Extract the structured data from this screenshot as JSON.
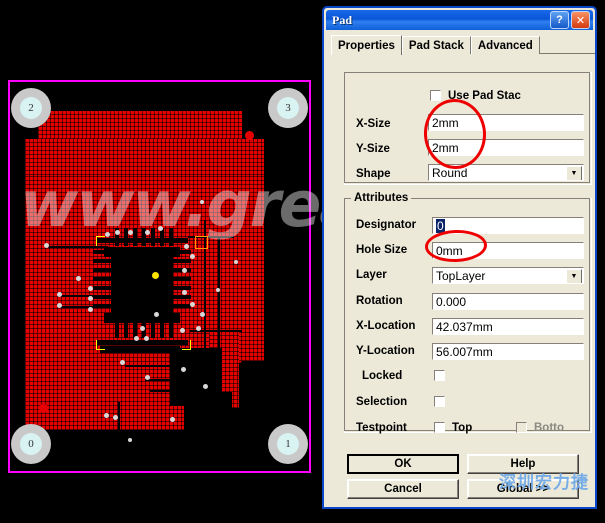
{
  "pcb": {
    "watermark": "www.great",
    "mount_pads": [
      {
        "label": "2",
        "corner": "top-left"
      },
      {
        "label": "3",
        "corner": "top-right"
      },
      {
        "label": "0",
        "corner": "bottom-left"
      },
      {
        "label": "1",
        "corner": "bottom-right"
      }
    ]
  },
  "dialog": {
    "title": "Pad",
    "help_button": "?",
    "close_button": "✕",
    "tabs": [
      {
        "label": "Properties",
        "active": true
      },
      {
        "label": "Pad Stack",
        "active": false
      },
      {
        "label": "Advanced",
        "active": false
      }
    ],
    "properties": {
      "use_pad_stack_label": "Use Pad Stac",
      "use_pad_stack_checked": false,
      "fields": [
        {
          "label": "X-Size",
          "value": "2mm",
          "type": "text"
        },
        {
          "label": "Y-Size",
          "value": "2mm",
          "type": "text"
        },
        {
          "label": "Shape",
          "value": "Round",
          "type": "combo"
        }
      ]
    },
    "attributes": {
      "group_label": "Attributes",
      "designator_label": "Designator",
      "designator_value": "0",
      "hole_size_label": "Hole Size",
      "hole_size_value": "0mm",
      "layer_label": "Layer",
      "layer_value": "TopLayer",
      "rotation_label": "Rotation",
      "rotation_value": "0.000",
      "x_location_label": "X-Location",
      "x_location_value": "42.037mm",
      "y_location_label": "Y-Location",
      "y_location_value": "56.007mm",
      "locked_label": "Locked",
      "locked_checked": false,
      "selection_label": "Selection",
      "selection_checked": false,
      "testpoint_label": "Testpoint",
      "testpoint_top_label": "Top",
      "testpoint_top_checked": false,
      "testpoint_bottom_label": "Botto",
      "testpoint_bottom_checked": false
    },
    "buttons": {
      "ok": "OK",
      "help": "Help",
      "cancel": "Cancel",
      "global": "Global >>"
    },
    "watermark": "深圳宏力捷"
  },
  "colors": {
    "titlebar_blue": "#0a56d8",
    "dialog_face": "#ece9d8",
    "copper_red": "#e60000",
    "board_outline": "#ff00ff",
    "annotation_red": "#ee0000"
  }
}
